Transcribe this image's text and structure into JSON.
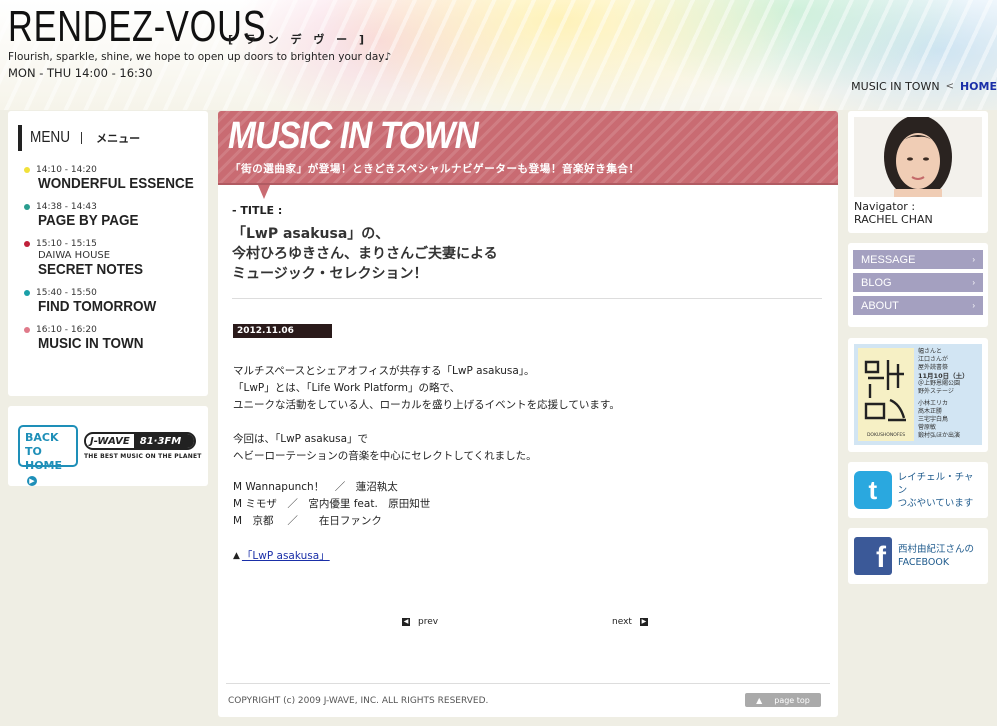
{
  "header": {
    "logo": "RENDEZ-VOUS",
    "logo_kana": "[ ラ ン デ ヴ ー ]",
    "tagline": "Flourish, sparkle, shine, we hope to open up doors to brighten your day♪",
    "schedule": "MON - THU 14:00 - 16:30"
  },
  "breadcrumb": {
    "current": "MUSIC IN TOWN",
    "separator": "<",
    "home": "HOME"
  },
  "menu": {
    "title_en": "MENU",
    "title_jp": "メニュー",
    "items": [
      {
        "time": "14:10 - 14:20",
        "sub": "",
        "name": "WONDERFUL ESSENCE",
        "dot_color": "#f1e13a"
      },
      {
        "time": "14:38 - 14:43",
        "sub": "",
        "name": "PAGE BY PAGE",
        "dot_color": "#2a9d8f"
      },
      {
        "time": "15:10 - 15:15",
        "sub": "DAIWA HOUSE",
        "name": "SECRET NOTES",
        "dot_color": "#c0203a"
      },
      {
        "time": "15:40 - 15:50",
        "sub": "",
        "name": "FIND TOMORROW",
        "dot_color": "#1aa0a8"
      },
      {
        "time": "16:10 - 16:20",
        "sub": "",
        "name": "MUSIC IN TOWN",
        "dot_color": "#e07a8a"
      }
    ]
  },
  "back": {
    "line1": "BACK TO",
    "line2": "HOME",
    "jwave_logo": "J-WAVE",
    "jwave_freq": "81·3FM",
    "jwave_slogan": "THE BEST MUSIC ON THE PLANET"
  },
  "main": {
    "banner_title": "MUSIC IN TOWN",
    "banner_sub": "「街の選曲家」が登場！ときどきスペシャルナビゲーターも登場！音楽好き集合！",
    "title_label": "- TITLE :",
    "title_lines": [
      "「LwP asakusa」の、",
      "今村ひろゆきさん、まりさんご夫妻による",
      "ミュージック・セレクション！"
    ],
    "date": "2012.11.06",
    "body_p1": [
      "マルチスペースとシェアオフィスが共存する「LwP asakusa」。",
      "「LwP」とは、「Life Work Platform」の略で、",
      "ユニークな活動をしている人、ローカルを盛り上げるイベントを応援しています。"
    ],
    "body_p2": [
      "今回は、「LwP asakusa」で",
      "ヘビーローテーションの音楽を中心にセレクトしてくれました。"
    ],
    "playlist": [
      "M Wannapunch！　／　蓮沼執太",
      "M ミモザ　／　宮内優里 feat.　原田知世",
      "M　京都　 ／　　在日ファンク"
    ],
    "link_marker": "▲",
    "link_text": "「LwP asakusa」",
    "prev": "prev",
    "next": "next",
    "copyright": "COPYRIGHT (c) 2009 J-WAVE, INC. ALL RIGHTS RESERVED.",
    "page_top": "page top"
  },
  "navigator": {
    "label": "Navigator :",
    "name": "RACHEL CHAN"
  },
  "side_links": [
    {
      "label": "MESSAGE"
    },
    {
      "label": "BLOG"
    },
    {
      "label": "ABOUT"
    }
  ],
  "fes": {
    "lines": [
      "幅さんと",
      "江口さんが",
      "屋外読書祭",
      "11月10日（土）",
      "＠上野恩賜公園",
      "野外ステージ",
      "",
      "小林エリカ",
      "髙木正勝",
      "三宅宇白鳥",
      "菅原敏",
      "鍛村弘ほか出演"
    ],
    "poster_text": "DOKUSHONOFES"
  },
  "twitter": {
    "line1": "レイチェル・チャン",
    "line2": "つぶやいています"
  },
  "facebook": {
    "line1": "西村由紀江さんの",
    "line2": "FACEBOOK"
  },
  "colors": {
    "banner": "#c96b72",
    "side_button": "#a4a0c0",
    "link": "#1a2fa8"
  }
}
